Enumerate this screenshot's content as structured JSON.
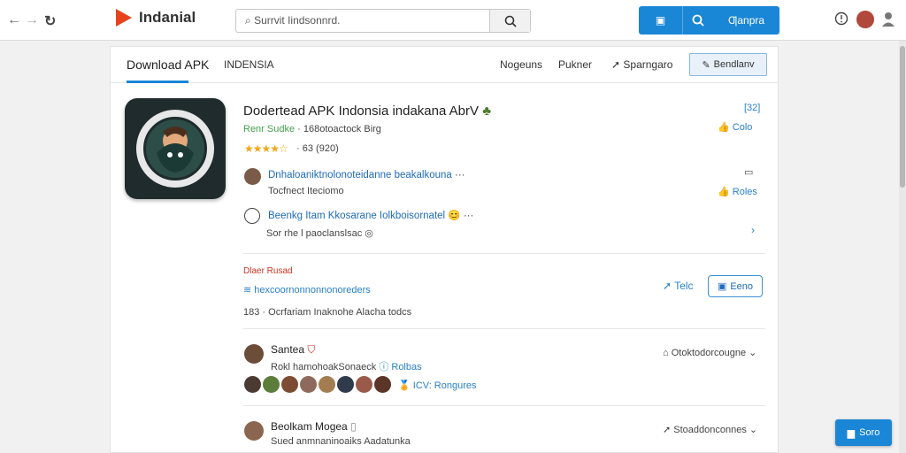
{
  "header": {
    "logo_text": "Indanial",
    "search_placeholder": "Surrvit Iindsonnrd.",
    "action_label": "Ƣanpra",
    "icons": [
      "back-icon",
      "forward-icon",
      "refresh-icon",
      "search-icon",
      "alert-icon",
      "avatar",
      "account-icon"
    ]
  },
  "tabs": {
    "active": "Download APK",
    "subtitle": "INDENSIA",
    "links": [
      "Nogeuns",
      "Pukner",
      "Sparngaro"
    ],
    "button": "Bendlanv"
  },
  "app": {
    "title": "Dodertead APK Indonsia indakana AbrV",
    "developer": "Renr Sudke",
    "developer_note": "· 168otoactock Birg",
    "rating_value": "63",
    "rating_count": "(920)",
    "side_count": "[32]",
    "side_label_1": "Colo",
    "side_label_2": "Roles"
  },
  "comments": [
    {
      "title": "Dnhaloaniktnolonoteidanne beakalkouna",
      "meta": "Tocfnect Iteciomo",
      "more": "···"
    },
    {
      "title": "Beenkg Itam Kkosarane Iolkboisornatel",
      "meta": "Sor rhe l paoclanslsac ◎",
      "more": "···"
    }
  ],
  "section": {
    "title": "Dlaer Rusad",
    "link": "hexcoornonnonnonoreders",
    "count": "183",
    "count_text": "· Ocrfariam Inaknohe Alacha todcs",
    "tell": "Telc",
    "button": "Eeno"
  },
  "reviews": [
    {
      "name": "Santea",
      "text": "Rokl hamohoakSonaeck",
      "badge": "Rolbas",
      "action": "Otoktodorcougne",
      "tail": "ICV: Rongures"
    },
    {
      "name": "Beolkam Mogea",
      "text": "Sued anmnaninoaiks Aadatunka",
      "action": "Stoaddonconnes"
    }
  ],
  "fab": {
    "label": "Soro"
  }
}
